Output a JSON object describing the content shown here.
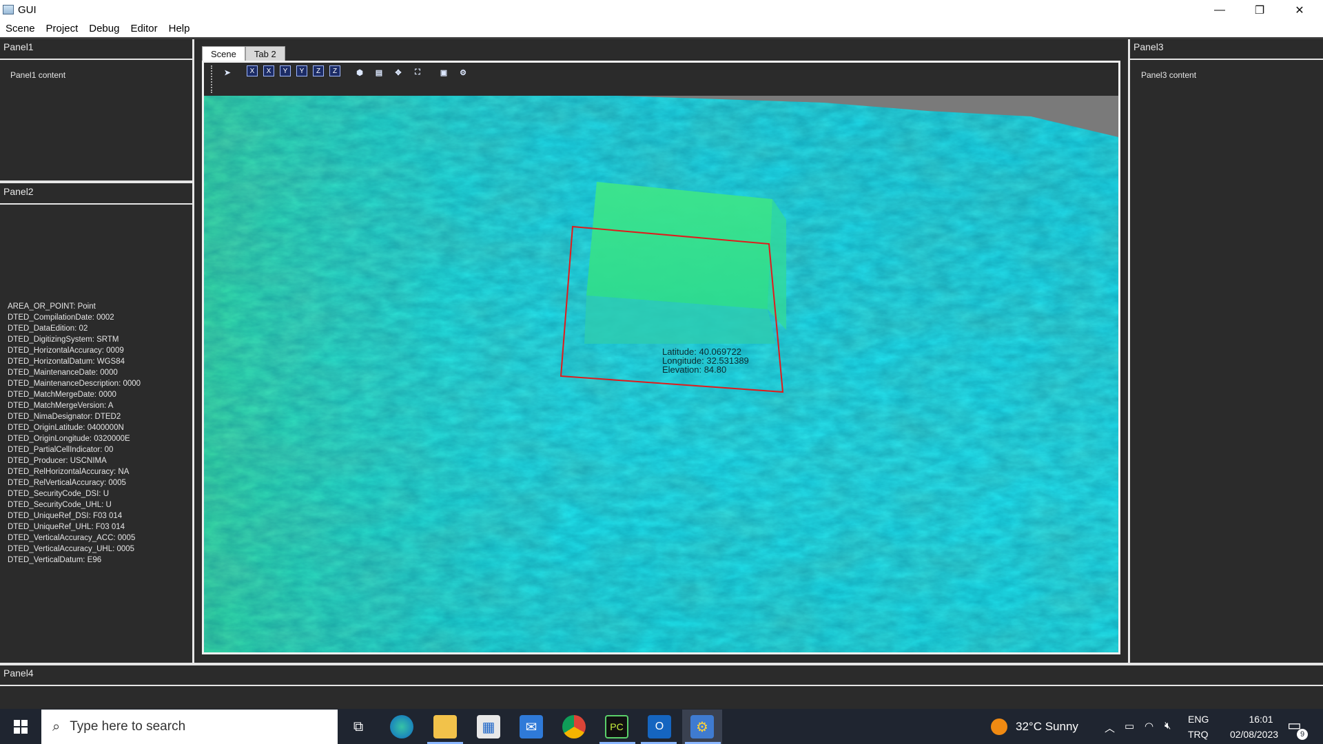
{
  "window": {
    "title": "GUI",
    "minimize": "—",
    "maximize": "❐",
    "close": "✕"
  },
  "menu": [
    "Scene",
    "Project",
    "Debug",
    "Editor",
    "Help"
  ],
  "panels": {
    "panel1": {
      "title": "Panel1",
      "content": "Panel1 content"
    },
    "panel2": {
      "title": "Panel2",
      "metadata": [
        "AREA_OR_POINT: Point",
        "DTED_CompilationDate: 0002",
        "DTED_DataEdition: 02",
        "DTED_DigitizingSystem: SRTM",
        "DTED_HorizontalAccuracy: 0009",
        "DTED_HorizontalDatum: WGS84",
        "DTED_MaintenanceDate: 0000",
        "DTED_MaintenanceDescription: 0000",
        "DTED_MatchMergeDate: 0000",
        "DTED_MatchMergeVersion: A",
        "DTED_NimaDesignator: DTED2",
        "DTED_OriginLatitude: 0400000N",
        "DTED_OriginLongitude: 0320000E",
        "DTED_PartialCellIndicator: 00",
        "DTED_Producer: USCNIMA",
        "DTED_RelHorizontalAccuracy: NA",
        "DTED_RelVerticalAccuracy: 0005",
        "DTED_SecurityCode_DSI: U",
        "DTED_SecurityCode_UHL: U",
        "DTED_UniqueRef_DSI: F03 014",
        "DTED_UniqueRef_UHL: F03 014",
        "DTED_VerticalAccuracy_ACC: 0005",
        "DTED_VerticalAccuracy_UHL: 0005",
        "DTED_VerticalDatum: E96"
      ]
    },
    "panel3": {
      "title": "Panel3",
      "content": "Panel3 content"
    },
    "panel4": {
      "title": "Panel4"
    }
  },
  "tabs": [
    {
      "label": "Scene",
      "active": true
    },
    {
      "label": "Tab 2",
      "active": false
    }
  ],
  "toolbar": {
    "buttons": [
      {
        "name": "select-tool-icon",
        "glyph": "➤"
      },
      {
        "name": "view-x-pos-icon",
        "glyph": "X"
      },
      {
        "name": "view-x-neg-icon",
        "glyph": "X"
      },
      {
        "name": "view-y-pos-icon",
        "glyph": "Y"
      },
      {
        "name": "view-y-neg-icon",
        "glyph": "Y"
      },
      {
        "name": "view-z-pos-icon",
        "glyph": "Z"
      },
      {
        "name": "view-z-neg-icon",
        "glyph": "Z"
      },
      {
        "name": "perspective-cube-icon",
        "glyph": "⬢"
      },
      {
        "name": "layers-icon",
        "glyph": "▤"
      },
      {
        "name": "move-icon",
        "glyph": "✥"
      },
      {
        "name": "fit-view-icon",
        "glyph": "⛶"
      },
      {
        "name": "save-icon",
        "glyph": "▣"
      },
      {
        "name": "settings-gear-icon",
        "glyph": "⚙"
      }
    ]
  },
  "scene": {
    "latitude": "Latitude: 40.069722",
    "longitude": "Longitude: 32.531389",
    "elevation": "Elevation: 84.80",
    "colors": {
      "terrain_low": "#1de4ee",
      "terrain_high": "#33e08a",
      "selection": "#e01b1b",
      "sky": "#7a7a7a"
    }
  },
  "taskbar": {
    "search_placeholder": "Type here to search",
    "weather": "32°C  Sunny",
    "lang_top": "ENG",
    "lang_bottom": "TRQ",
    "time": "16:01",
    "date": "02/08/2023",
    "notifications": "9",
    "apps": [
      "task-view-icon",
      "edge-icon",
      "file-explorer-icon",
      "store-icon",
      "mail-icon",
      "chrome-icon",
      "pycharm-icon",
      "outlook-icon",
      "python-app-icon"
    ]
  }
}
